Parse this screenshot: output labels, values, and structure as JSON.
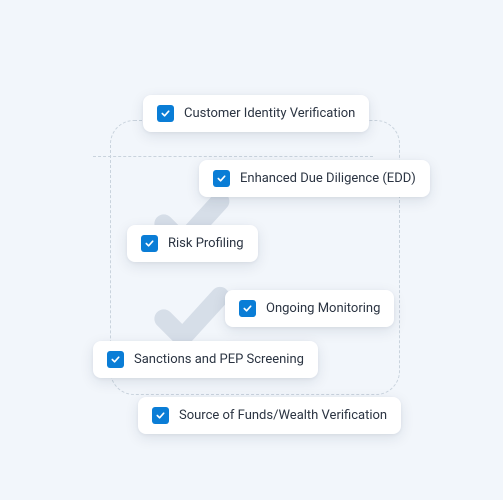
{
  "accent": "#0a7dd6",
  "chips": {
    "c1": {
      "label": "Customer Identity Verification"
    },
    "c2": {
      "label": "Enhanced Due Diligence (EDD)"
    },
    "c3": {
      "label": "Risk Profiling"
    },
    "c4": {
      "label": "Ongoing Monitoring"
    },
    "c5": {
      "label": "Sanctions and PEP Screening"
    },
    "c6": {
      "label": "Source of Funds/Wealth Verification"
    }
  }
}
